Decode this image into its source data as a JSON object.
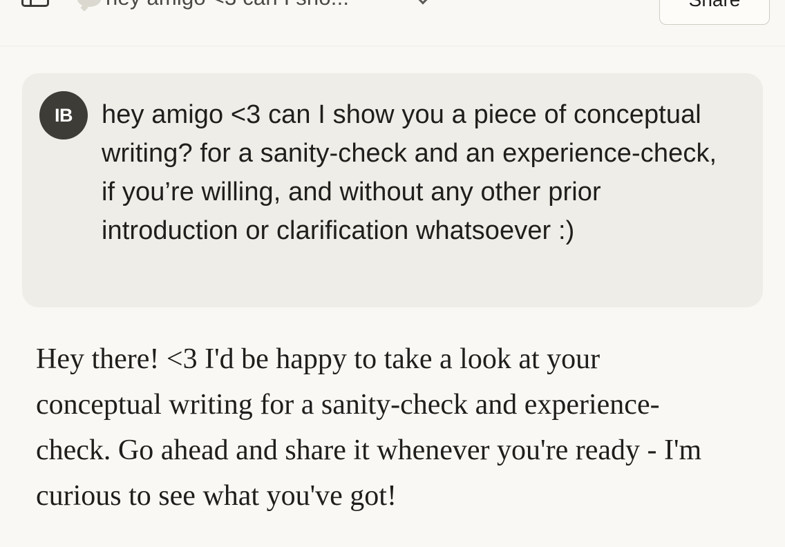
{
  "header": {
    "sidebar_toggle_icon": "sidebar-icon",
    "chat_icon": "speech-bubble-icon",
    "conversation_title": "hey amigo <3 can I sho...",
    "dropdown_icon": "chevron-down-icon",
    "share_label": "Share"
  },
  "user_message": {
    "avatar_initials": "IB",
    "text": "hey amigo <3 can I show you a piece of conceptual writing? for a sanity-check and an experience-check, if you’re willing, and without any other prior introduction or clarification whatsoever :)"
  },
  "assistant_message": {
    "text": "Hey there! <3 I'd be happy to take a look at your conceptual writing for a sanity-check and experience-check. Go ahead and share it whenever you're ready - I'm curious to see what you've got!"
  },
  "colors": {
    "background": "#f9f8f4",
    "user_bubble": "#efede7",
    "avatar": "#3e3c37",
    "text": "#1f1e1c"
  }
}
